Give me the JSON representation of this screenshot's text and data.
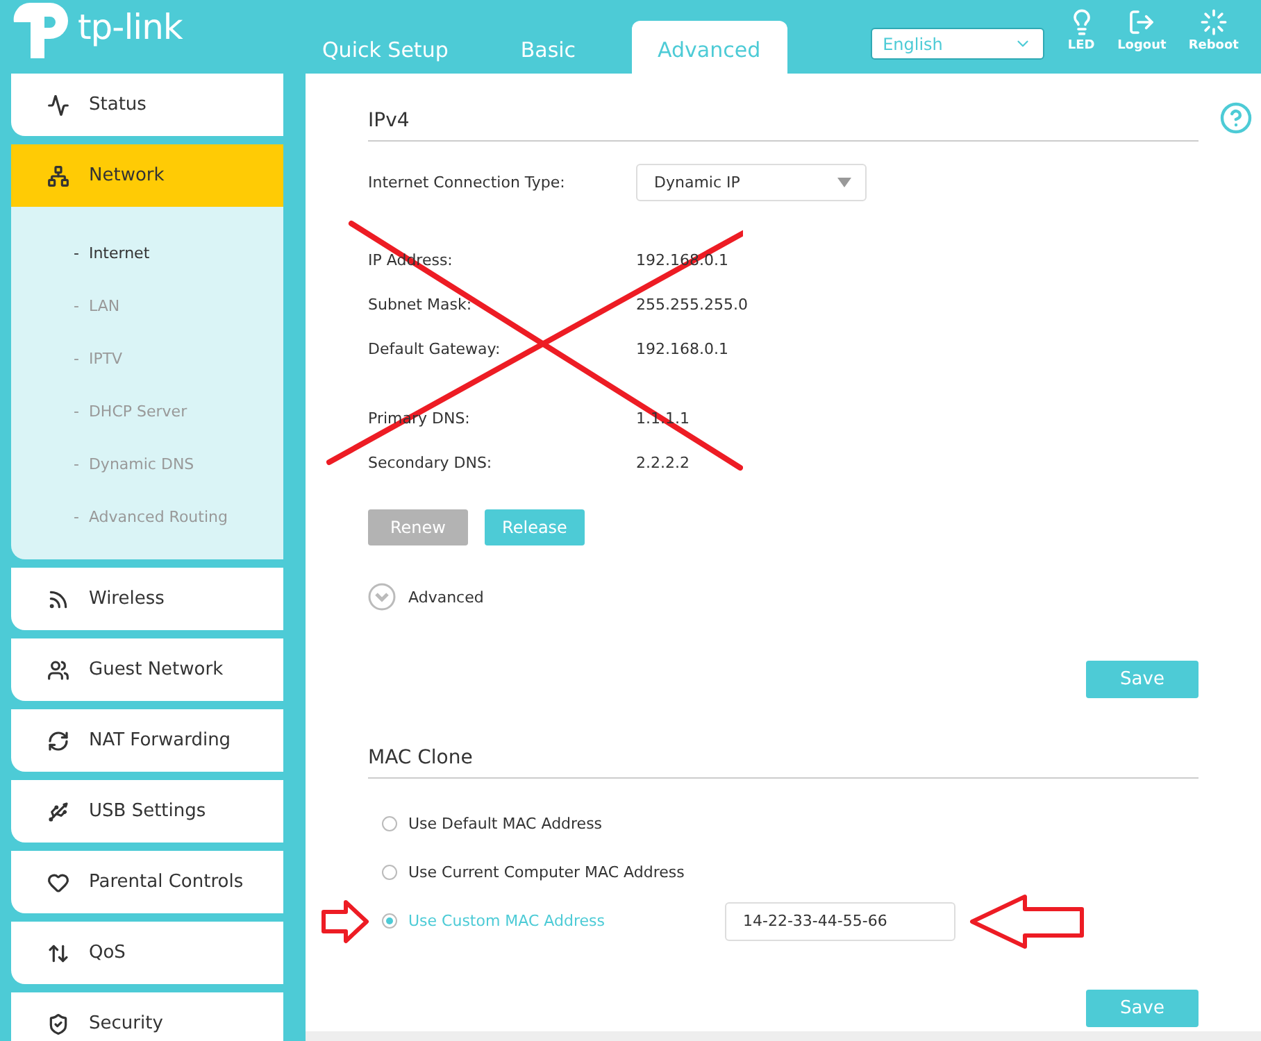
{
  "logo": "tp-link",
  "tabs": [
    {
      "label": "Quick Setup",
      "selected": false
    },
    {
      "label": "Basic",
      "selected": false
    },
    {
      "label": "Advanced",
      "selected": true
    }
  ],
  "language": "English",
  "header_actions": [
    {
      "label": "LED"
    },
    {
      "label": "Logout"
    },
    {
      "label": "Reboot"
    }
  ],
  "sidebar": {
    "items": [
      {
        "label": "Status",
        "selected": false,
        "expanded": false
      },
      {
        "label": "Network",
        "selected": true,
        "expanded": true,
        "children": [
          {
            "label": "-  Internet",
            "selected": true
          },
          {
            "label": "-  LAN",
            "selected": false
          },
          {
            "label": "-  IPTV",
            "selected": false
          },
          {
            "label": "-  DHCP Server",
            "selected": false
          },
          {
            "label": "-  Dynamic DNS",
            "selected": false
          },
          {
            "label": "-  Advanced Routing",
            "selected": false
          }
        ]
      },
      {
        "label": "Wireless",
        "selected": false,
        "expanded": false
      },
      {
        "label": "Guest Network",
        "selected": false,
        "expanded": false
      },
      {
        "label": "NAT Forwarding",
        "selected": false,
        "expanded": false
      },
      {
        "label": "USB Settings",
        "selected": false,
        "expanded": false
      },
      {
        "label": "Parental Controls",
        "selected": false,
        "expanded": false
      },
      {
        "label": "QoS",
        "selected": false,
        "expanded": false
      },
      {
        "label": "Security",
        "selected": false,
        "expanded": false
      }
    ]
  },
  "ipv4": {
    "title": "IPv4",
    "crossed_out": true,
    "connection_type": {
      "label": "Internet Connection Type:",
      "value": "Dynamic IP"
    },
    "field_groups": [
      [
        {
          "label": "IP Address:",
          "value": "192.168.0.1"
        },
        {
          "label": "Subnet Mask:",
          "value": "255.255.255.0"
        },
        {
          "label": "Default Gateway:",
          "value": "192.168.0.1"
        }
      ],
      [
        {
          "label": "Primary DNS:",
          "value": "1.1.1.1"
        },
        {
          "label": "Secondary DNS:",
          "value": "2.2.2.2"
        }
      ]
    ],
    "buttons": [
      {
        "label": "Renew",
        "disabled": true
      },
      {
        "label": "Release",
        "disabled": false
      }
    ],
    "advanced": {
      "label": "Advanced",
      "expanded": false
    },
    "save": "Save"
  },
  "mac_clone": {
    "title": "MAC Clone",
    "arrows": true,
    "options": [
      {
        "label": "Use Default MAC Address",
        "selected": false
      },
      {
        "label": "Use Current Computer MAC Address",
        "selected": false
      },
      {
        "label": "Use Custom MAC Address",
        "selected": true,
        "value": "14-22-33-44-55-66"
      }
    ],
    "save": "Save"
  }
}
